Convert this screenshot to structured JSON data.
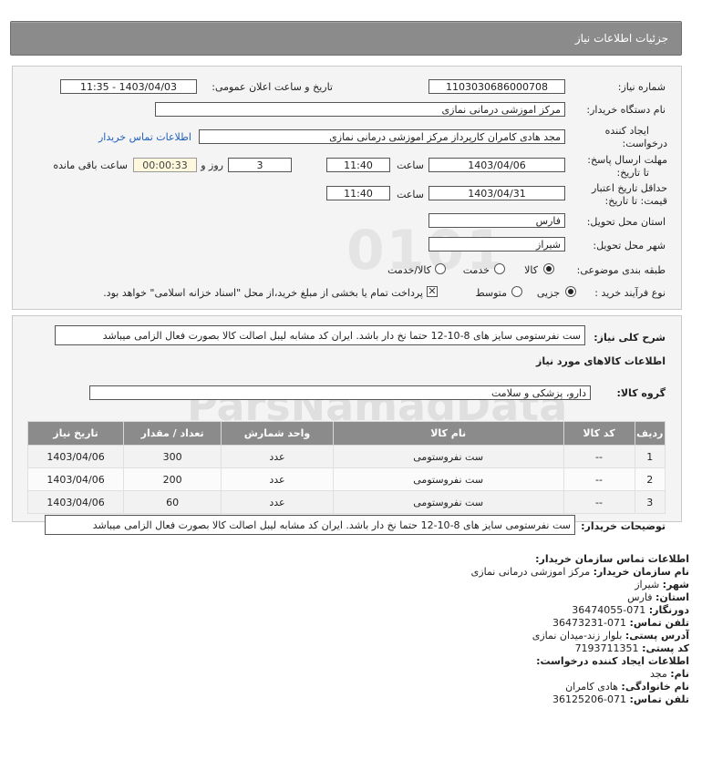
{
  "header": {
    "title": "جزئیات اطلاعات نیاز"
  },
  "form": {
    "need_number_label": "شماره نیاز:",
    "need_number": "1103030686000708",
    "announce_label": "تاریخ و ساعت اعلان عمومی:",
    "announce_value": "1403/04/03 - 11:35",
    "buyer_org_label": "نام دستگاه خریدار:",
    "buyer_org": "مرکز اموزشی درمانی نمازی",
    "creator_label_1": "ایجاد کننده",
    "creator_label_2": "درخواست:",
    "creator": "مجد هادی کامران کارپرداز مرکز اموزشی درمانی نمازی",
    "contact_link": "اطلاعات تماس خریدار",
    "reply_deadline_label_1": "مهلت ارسال پاسخ:",
    "reply_deadline_label_2": "تا تاریخ:",
    "reply_date": "1403/04/06",
    "time_label": "ساعت",
    "reply_time": "11:40",
    "days": "3",
    "days_label": "روز و",
    "remaining": "00:00:33",
    "remaining_label": "ساعت باقی مانده",
    "validity_label_1": "حداقل تاریخ اعتبار",
    "validity_label_2": "قیمت: تا تاریخ:",
    "validity_date": "1403/04/31",
    "validity_time": "11:40",
    "province_label": "استان محل تحویل:",
    "province": "فارس",
    "city_label": "شهر محل تحویل:",
    "city": "شیراز",
    "category_label": "طبقه بندی موضوعی:",
    "cat_goods": "کالا",
    "cat_service": "خدمت",
    "cat_both": "کالا/خدمت",
    "process_label": "نوع فرآیند خرید :",
    "proc_partial": "جزیی",
    "proc_medium": "متوسط",
    "payment_note": "پرداخت تمام یا بخشی از مبلغ خرید،از محل \"اسناد خزانه اسلامی\" خواهد بود."
  },
  "summary": {
    "label": "شرح کلی نیاز:",
    "text": "ست نفرستومی سایز های 8-10-12 حتما نخ دار باشد. ایران کد مشابه لیبل اصالت کالا بصورت فعال الزامی میباشد",
    "goods_info_title": "اطلاعات کالاهای مورد نیاز",
    "group_label": "گروه کالا:",
    "group_value": "دارو، پزشکی و سلامت"
  },
  "table": {
    "headers": [
      "ردیف",
      "کد کالا",
      "نام کالا",
      "واحد شمارش",
      "تعداد / مقدار",
      "تاریخ نیاز"
    ],
    "rows": [
      [
        "1",
        "--",
        "ست نفروستومی",
        "عدد",
        "300",
        "1403/04/06"
      ],
      [
        "2",
        "--",
        "ست نفروستومی",
        "عدد",
        "200",
        "1403/04/06"
      ],
      [
        "3",
        "--",
        "ست نفروستومی",
        "عدد",
        "60",
        "1403/04/06"
      ]
    ]
  },
  "buyer_notes": {
    "label": "توضیحات خریدار:",
    "text": "ست نفرستومی سایز های 8-10-12 حتما نخ دار باشد. ایران کد مشابه لیبل اصالت کالا بصورت فعال الزامی میباشد"
  },
  "contact": {
    "title": "اطلاعات تماس سازمان خریدار:",
    "org_k": "نام سازمان خریدار:",
    "org_v": "مرکز اموزشی درمانی نمازی",
    "city_k": "شهر:",
    "city_v": "شیراز",
    "province_k": "استان:",
    "province_v": "فارس",
    "fax_k": "دورنگار:",
    "fax_v": "071-36474055",
    "phone_k": "تلفن تماس:",
    "phone_v": "071-36473231",
    "address_k": "آدرس پستی:",
    "address_v": "بلوار زند-میدان نمازی",
    "postal_k": "کد پستی:",
    "postal_v": "7193711351",
    "creator_title": "اطلاعات ایجاد کننده درخواست:",
    "name_k": "نام:",
    "name_v": "مجد",
    "family_k": "نام خانوادگی:",
    "family_v": "هادی کامران",
    "cphone_k": "تلفن تماس:",
    "cphone_v": "071-36125206"
  },
  "watermark": {
    "text": "ParsNamadData"
  }
}
